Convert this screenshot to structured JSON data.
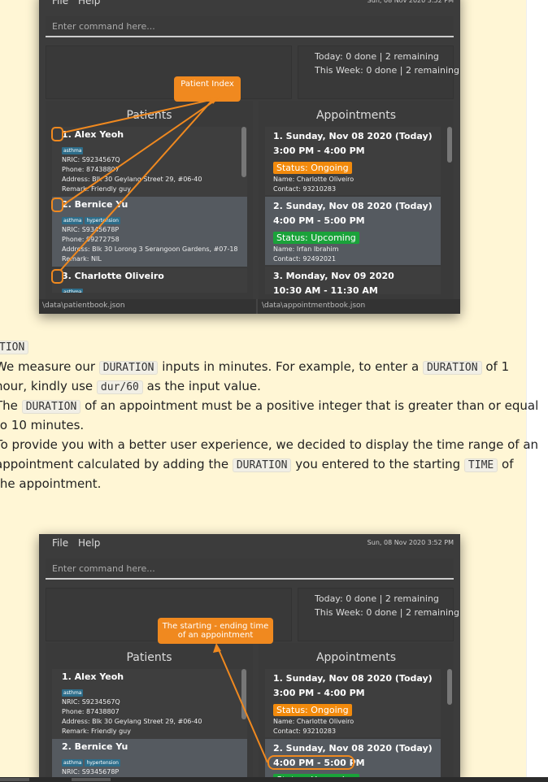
{
  "app": {
    "menu_file": "File",
    "menu_help": "Help",
    "datetime": "Sun, 08 Nov 2020 3:52 PM",
    "command_placeholder": "Enter command here...",
    "today_summary": "Today: 0 done | 2 remaining",
    "week_summary": "This Week: 0 done | 2 remaining",
    "patients_title": "Patients",
    "appointments_title": "Appointments",
    "patient_file": "\\data\\patientbook.json",
    "appointment_file": "\\data\\appointmentbook.json",
    "patients": [
      {
        "name": "1. Alex Yeoh",
        "tags": [
          "asthma"
        ],
        "nric": "NRIC: S9234567Q",
        "phone": "Phone: 87438807",
        "address": "Address: Blk 30 Geylang Street 29, #06-40",
        "remark": "Remark: Friendly guy"
      },
      {
        "name": "2. Bernice Yu",
        "tags": [
          "asthma",
          "hypertension"
        ],
        "nric": "NRIC: S9345678P",
        "phone": "Phone: 99272758",
        "address": "Address: Blk 30 Lorong 3 Serangoon Gardens, #07-18",
        "remark": "Remark: NIL"
      },
      {
        "name": "3. Charlotte Oliveiro",
        "tags": [
          "asthma"
        ]
      }
    ],
    "appointments": [
      {
        "head": "1. Sunday, Nov 08 2020 (Today)",
        "time": "3:00 PM - 4:00 PM",
        "status": "Status: Ongoing",
        "name": "Name: Charlotte Oliveiro",
        "contact": "Contact: 93210283"
      },
      {
        "head": "2. Sunday, Nov 08 2020 (Today)",
        "time": "4:00 PM - 5:00 PM",
        "status": "Status: Upcoming",
        "name": "Name: Irfan Ibrahim",
        "contact": "Contact: 92492021"
      },
      {
        "head": "3. Monday, Nov 09 2020",
        "time": "10:30 AM - 11:30 AM"
      }
    ]
  },
  "callouts": {
    "patient_index": "Patient Index",
    "time_range": "The starting - ending time of an appointment"
  },
  "doc": {
    "heading_fragment": "TION",
    "p1_a": "We measure our",
    "p1_code": "DURATION",
    "p1_b": "inputs in minutes. For example, to enter a",
    "p1_code2": "DURATION",
    "p1_c": "of 1",
    "p2_a": "hour, kindly use",
    "p2_code": "dur/60",
    "p2_b": "as the input value.",
    "p3_a": "The",
    "p3_code": "DURATION",
    "p3_b": "of an appointment must be a positive integer that is greater than or equal",
    "p4": "to 10 minutes.",
    "p5": "To provide you with a better user experience, we decided to display the time range of an",
    "p6_a": "appointment calculated by adding the",
    "p6_code": "DURATION",
    "p6_b": "you entered to the starting",
    "p6_code2": "TIME",
    "p6_c": "of",
    "p7": "the appointment."
  }
}
